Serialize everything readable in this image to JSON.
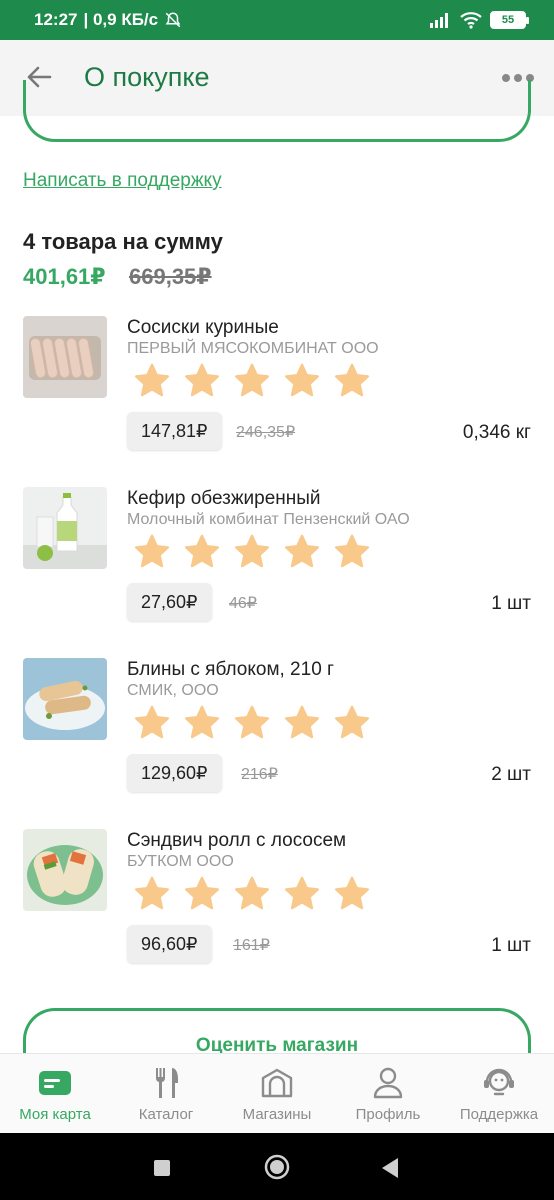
{
  "status_bar": {
    "time": "12:27",
    "network_speed": "| 0,9 КБ/с",
    "battery": "55"
  },
  "header": {
    "title": "О покупке"
  },
  "support_link": "Написать в поддержку",
  "summary": {
    "title": "4 товара на сумму",
    "total": "401,61₽",
    "total_old": "669,35₽"
  },
  "items": [
    {
      "name": "Сосиски куриные",
      "maker": "ПЕРВЫЙ МЯСОКОМБИНАТ ООО",
      "price": "147,81₽",
      "price_old": "246,35₽",
      "qty": "0,346 кг",
      "rating": 5
    },
    {
      "name": "Кефир обезжиренный",
      "maker": "Молочный комбинат Пензенский ОАО",
      "price": "27,60₽",
      "price_old": "46₽",
      "qty": "1 шт",
      "rating": 5
    },
    {
      "name": "Блины с яблоком, 210 г",
      "maker": "СМИК, ООО",
      "price": "129,60₽",
      "price_old": "216₽",
      "qty": "2 шт",
      "rating": 5
    },
    {
      "name": "Сэндвич ролл с лососем",
      "maker": "БУТКОМ ООО",
      "price": "96,60₽",
      "price_old": "161₽",
      "qty": "1 шт",
      "rating": 5
    }
  ],
  "rate_button": "Оценить магазин",
  "bottom_nav": {
    "items": [
      {
        "label": "Моя карта",
        "icon": "card-icon",
        "active": true
      },
      {
        "label": "Каталог",
        "icon": "cutlery-icon",
        "active": false
      },
      {
        "label": "Магазины",
        "icon": "store-icon",
        "active": false
      },
      {
        "label": "Профиль",
        "icon": "profile-icon",
        "active": false
      },
      {
        "label": "Поддержка",
        "icon": "support-icon",
        "active": false
      }
    ]
  },
  "colors": {
    "brand_green": "#36a862",
    "status_bar": "#1e8a4c",
    "star": "#f8c98a"
  }
}
